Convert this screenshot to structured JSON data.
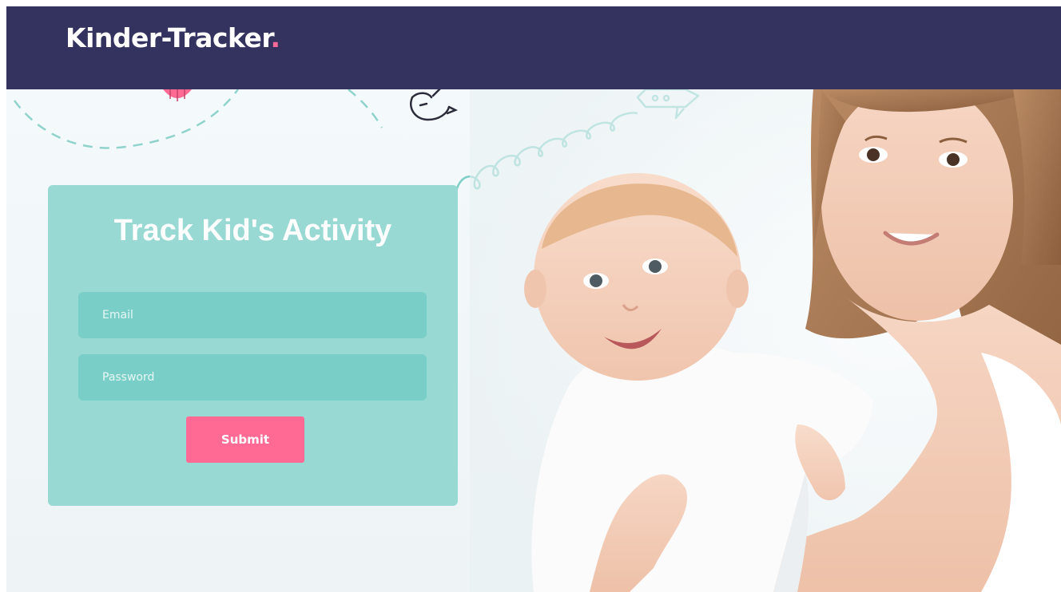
{
  "header": {
    "brand": "Kinder-Tracker",
    "brand_dot": "."
  },
  "login": {
    "title": "Track Kid's Activity",
    "email_placeholder": "Email",
    "password_placeholder": "Password",
    "submit_label": "Submit"
  },
  "colors": {
    "header_bg": "#34325f",
    "card_bg": "#99d9d3",
    "input_bg": "#79cec7",
    "accent_pink": "#ff6a95"
  },
  "icons": [
    "bird-doodle-icon",
    "ball-doodle-icon",
    "rocket-doodle-icon"
  ]
}
